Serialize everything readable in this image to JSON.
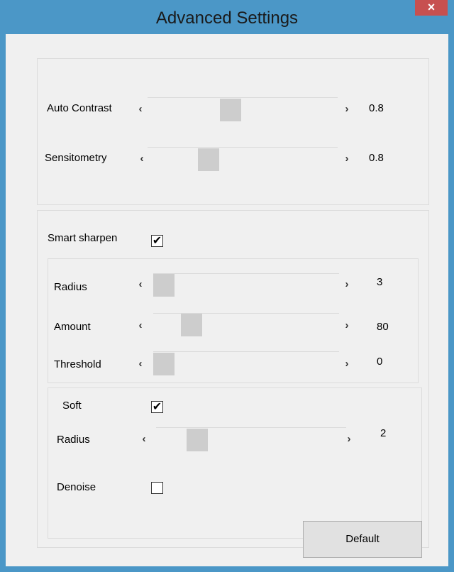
{
  "window": {
    "title": "Advanced Settings",
    "close_glyph": "×"
  },
  "arrows": {
    "left": "‹",
    "right": "›"
  },
  "top_group": {
    "auto_contrast": {
      "label": "Auto Contrast",
      "value": "0.8",
      "level": 0.43
    },
    "sensitometry": {
      "label": "Sensitometry",
      "value": "0.8",
      "level": 0.3
    }
  },
  "sharpen_group": {
    "smart_sharpen": {
      "label": "Smart sharpen",
      "checked": true
    },
    "radius": {
      "label": "Radius",
      "value": "3",
      "level": 0.0
    },
    "amount": {
      "label": "Amount",
      "value": "80",
      "level": 0.17
    },
    "threshold": {
      "label": "Threshold",
      "value": "0",
      "level": 0.0
    }
  },
  "soft_group": {
    "soft": {
      "label": "Soft",
      "checked": true
    },
    "radius": {
      "label": "Radius",
      "value": "2",
      "level": 0.18
    },
    "denoise": {
      "label": "Denoise",
      "checked": false
    }
  },
  "buttons": {
    "default_label": "Default"
  },
  "colors": {
    "titlebar": "#4b97c7",
    "close": "#c75050",
    "thumb": "#cdcdcd",
    "panel": "#f0f0f0"
  }
}
